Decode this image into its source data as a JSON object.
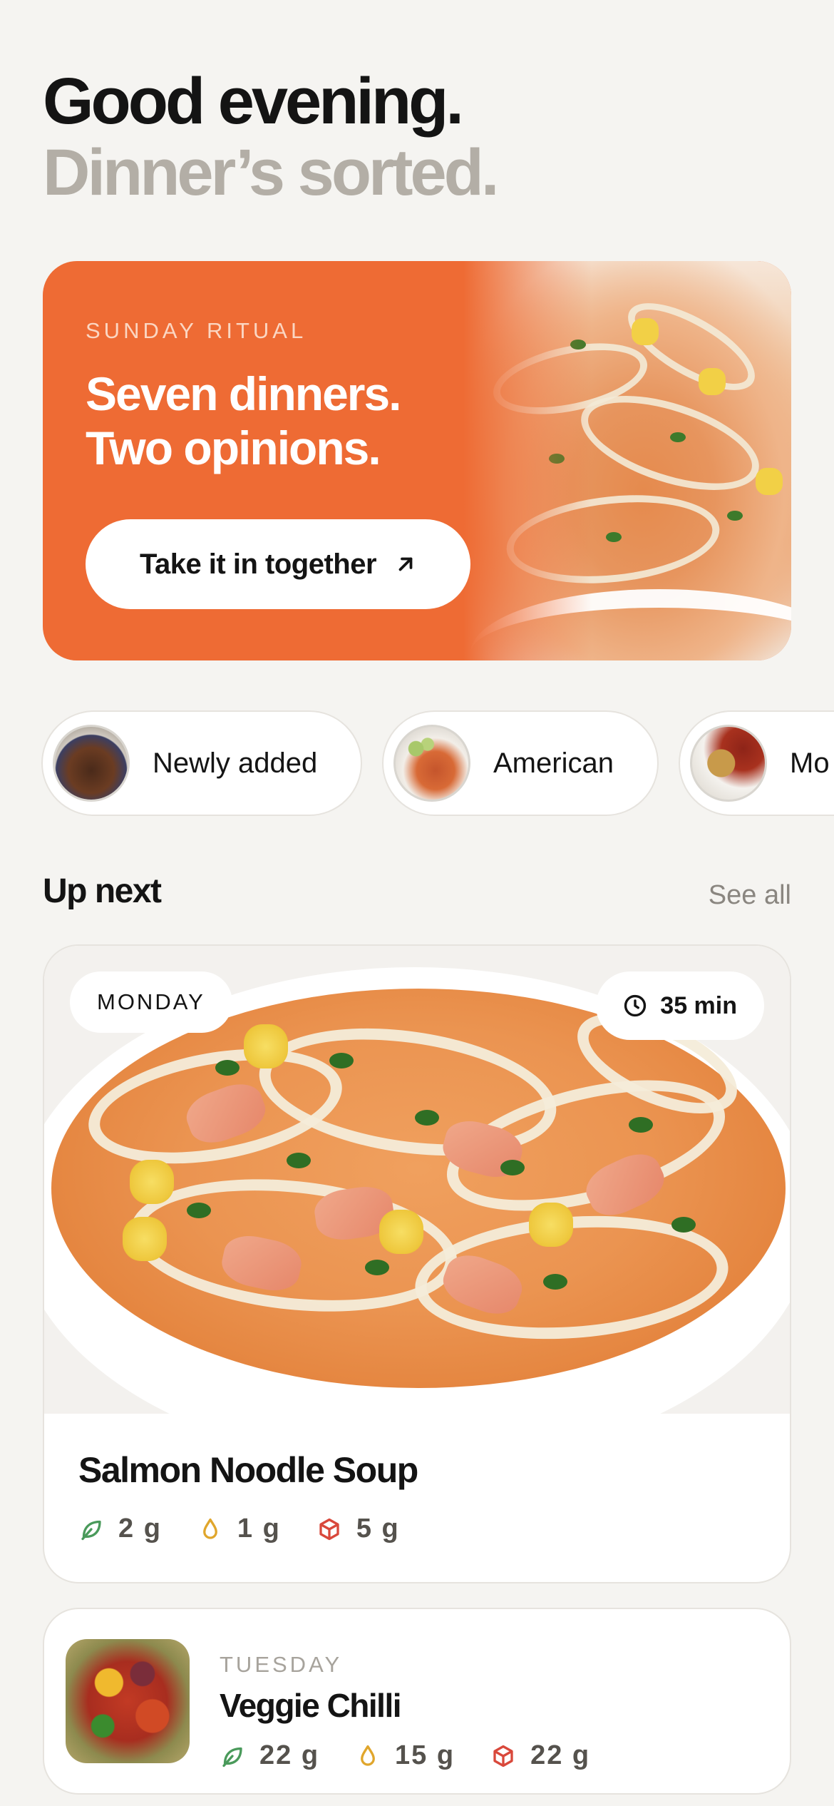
{
  "greeting": {
    "line1": "Good evening.",
    "line2": "Dinner’s sorted."
  },
  "hero": {
    "kicker": "SUNDAY RITUAL",
    "title_line1": "Seven dinners.",
    "title_line2": "Two opinions.",
    "cta_label": "Take it in together",
    "cta_icon": "arrow-up-right-icon",
    "accent_color": "#ee6b34"
  },
  "categories": [
    {
      "label": "Newly added",
      "thumb": "dessert-bowl"
    },
    {
      "label": "American",
      "thumb": "curry-plate"
    },
    {
      "label": "Mo",
      "thumb": "chickpea-stew"
    }
  ],
  "up_next": {
    "title": "Up next",
    "see_all": "See all"
  },
  "featured": {
    "day": "MONDAY",
    "time": "35 min",
    "time_icon": "clock-icon",
    "name": "Salmon Noodle Soup",
    "macros": [
      {
        "icon": "leaf-icon",
        "value": "2 g",
        "color": "#4a9a5b"
      },
      {
        "icon": "drop-icon",
        "value": "1 g",
        "color": "#e0a62c"
      },
      {
        "icon": "cube-icon",
        "value": "5 g",
        "color": "#d9483b"
      }
    ]
  },
  "next_item": {
    "day": "TUESDAY",
    "name": "Veggie Chilli",
    "macros": [
      {
        "icon": "leaf-icon",
        "value": "22 g",
        "color": "#4a9a5b"
      },
      {
        "icon": "drop-icon",
        "value": "15 g",
        "color": "#e0a62c"
      },
      {
        "icon": "cube-icon",
        "value": "22 g",
        "color": "#d9483b"
      }
    ]
  }
}
